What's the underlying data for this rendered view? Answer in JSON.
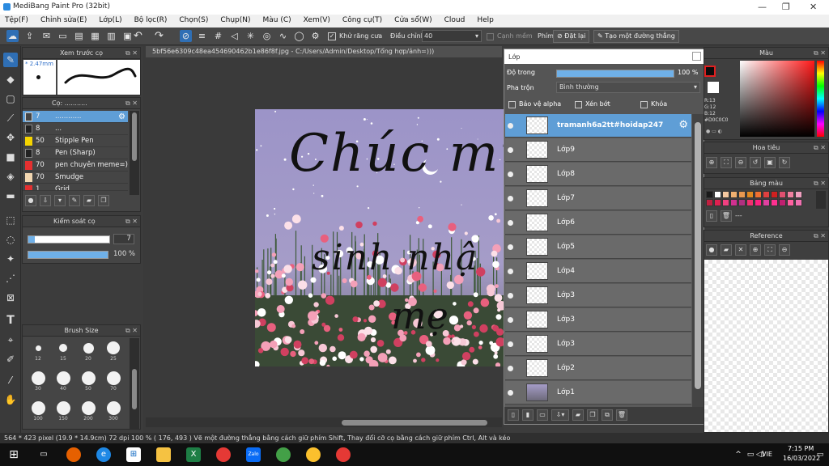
{
  "window": {
    "title": "MediBang Paint Pro (32bit)",
    "min": "—",
    "max": "❐",
    "close": "✕"
  },
  "menu": [
    "Tệp(F)",
    "Chỉnh sửa(E)",
    "Lớp(L)",
    "Bộ lọc(R)",
    "Chọn(S)",
    "Chụp(N)",
    "Màu (C)",
    "Xem(V)",
    "Công cụ(T)",
    "Cửa sổ(W)",
    "Cloud",
    "Help"
  ],
  "toolbar": {
    "antialias_label": "Khử răng cưa",
    "adjust_label": "Điều chỉnh",
    "adjust_value": "40",
    "smooth_edge_label": "Cạnh mềm",
    "key_label": "Phím",
    "reset_label": "Đặt lại",
    "create_line_label": "Tạo một đường thẳng"
  },
  "preview_panel": {
    "title": "Xem trước cọ",
    "size": "* 2.47mm"
  },
  "brush_panel": {
    "title": "Cọ: ...........",
    "brushes": [
      {
        "size": "7",
        "name": "............",
        "color": "#5f9ed6",
        "selected": true
      },
      {
        "size": "8",
        "name": "...",
        "color": "#222222"
      },
      {
        "size": "50",
        "name": "Stipple Pen",
        "color": "#f5d400"
      },
      {
        "size": "8",
        "name": "Pen (Sharp)",
        "color": "#222222"
      },
      {
        "size": "70",
        "name": "pen chuyên meme=)",
        "color": "#e53030"
      },
      {
        "size": "70",
        "name": "Smudge",
        "color": "#f2d6b0"
      },
      {
        "size": "1",
        "name": "Grid",
        "color": "#e53030"
      }
    ]
  },
  "brush_control": {
    "title": "Kiểm soát cọ",
    "size_value": "7",
    "opacity_value": "100 %",
    "size_fill": 0.08,
    "opacity_fill": 1.0
  },
  "brush_size": {
    "title": "Brush Size",
    "sizes": [
      "12",
      "15",
      "20",
      "25",
      "30",
      "40",
      "50",
      "70",
      "100",
      "150",
      "200",
      "300"
    ]
  },
  "document": {
    "tab": "5bf56e6309c48ea454690462b1e86f8f.jpg - C:/Users/Admin/Desktop/Tổng hợp/ảnh=)))"
  },
  "artwork": {
    "line1": "Chúc mừ",
    "line2": "sinh nhậ",
    "line3": "mẹ"
  },
  "layer_panel": {
    "title": "Lớp",
    "opacity_label": "Độ trong",
    "opacity_value": "100 %",
    "opacity_fill": 1.0,
    "blend_label": "Pha trộn",
    "blend_value": "Bình thường",
    "protect_alpha": "Bảo vệ alpha",
    "clipping": "Xén bớt",
    "lock": "Khóa",
    "layers": [
      "tramanh6a2tt#hoidap247",
      "Lớp9",
      "Lớp8",
      "Lớp7",
      "Lớp6",
      "Lớp5",
      "Lớp4",
      "Lớp3",
      "Lớp3",
      "Lớp3",
      "Lớp2",
      "Lớp1"
    ]
  },
  "color_panel": {
    "title": "Màu",
    "hex": "#D0C0C0",
    "r": "R:13",
    "g": "G:12",
    "b": "B:12"
  },
  "navigator": {
    "title": "Hoa tiêu"
  },
  "palette": {
    "title": "Bảng màu",
    "dash": "---",
    "colors": [
      "#1a1a1a",
      "#ffffff",
      "#f5c8a0",
      "#f0b070",
      "#e89850",
      "#e08820",
      "#f07030",
      "#e04040",
      "#d02020",
      "#e05070",
      "#f080a0",
      "#f0a0c0",
      "#c02040",
      "#e02050",
      "#f04080",
      "#d03090",
      "#b03080",
      "#f03070",
      "#ff2080",
      "#e040a0",
      "#ff3090",
      "#c02070",
      "#ff60a0",
      "#f070b0"
    ]
  },
  "reference": {
    "title": "Reference"
  },
  "status": {
    "text": "564 * 423 pixel   (19.9 * 14.9cm)   72 dpi   100 %   ( 176, 493 )   Vẽ một đường thẳng bằng cách giữ phím Shift, Thay đổi cỡ cọ bằng cách giữ phím Ctrl, Alt và kéo"
  },
  "taskbar": {
    "lang": "VIE",
    "time": "7:15 PM",
    "date": "16/03/2022"
  }
}
